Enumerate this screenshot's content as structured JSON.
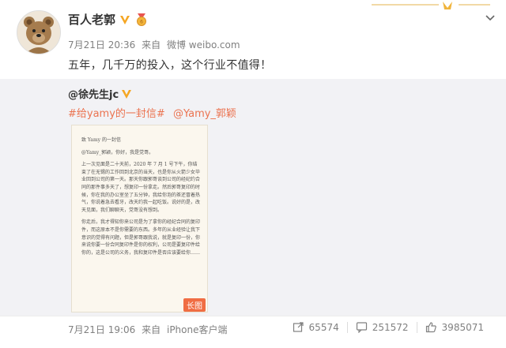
{
  "post": {
    "author": "百人老郭",
    "date": "7月21日 20:36",
    "source_prefix": "来自",
    "source": "微博 weibo.com",
    "content": "五年，几千万的投入，这个行业不值得！"
  },
  "repost": {
    "user": "@徐先生jc",
    "tags": [
      "#给yamy的一封信#",
      "@Yamy_郭颖"
    ],
    "long_image_label": "长图",
    "letter_lines": [
      "致 Yamy 的一封信",
      "@Yamy_郭颖，你好，我是党哥。",
      "上一次见面是二十天前，2020 年 7 月 1 号下午，你结束了在无锡的工作回到北京的当天，也是你从火箭少女毕业回到公司的第一天。那天你跟郭哥谈到公司的经纪约合同的那件事多天了，想复印一份拿走。然后郭哥复印的时候，你在我的办公室坐了五分钟，我给你泡的茶还冒着热气，你说着急去看牙，改天约我一起吃饭。说好的是，改天见面，我们聊聊天，党哥没有想到。",
      "你走后，我才得知你来公司是为了拿你的经纪合同的复印件，而这原本不是你需要的东西。多年的从业经验让我下意识的觉得有问题，但是郭哥跟我说，就是复印一份，你来说你要一份合同复印件是你的权利，公司是要复印件给你的，这是公司的义务，我和复印件是否应该要给你……"
    ]
  },
  "footer": {
    "date": "7月21日 19:06",
    "source_prefix": "来自",
    "source": "iPhone客户端",
    "reposts": "65574",
    "comments": "251572",
    "likes": "3985071"
  },
  "colors": {
    "accent_orange": "#eb7350",
    "verified_gold": "#f5a623",
    "repost_bg": "#f2f2f5",
    "meta_gray": "#808080"
  },
  "icons": [
    "chevron-down-icon",
    "verified-v-icon",
    "medal-icon",
    "repost-icon",
    "comment-icon",
    "like-icon"
  ]
}
